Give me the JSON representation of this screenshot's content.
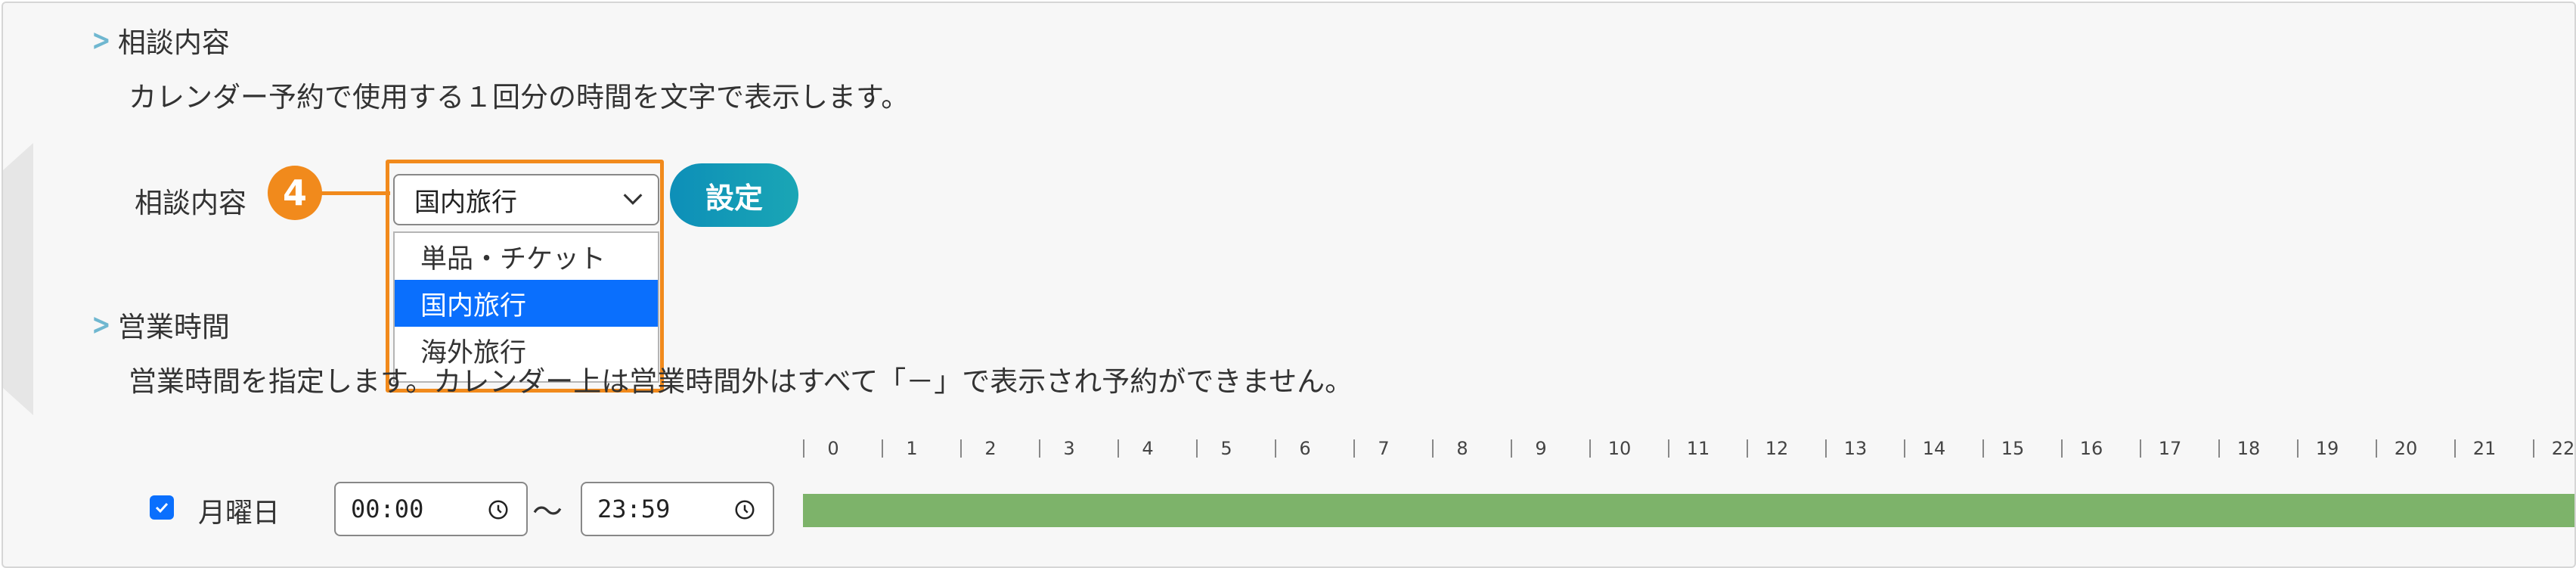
{
  "consultation": {
    "heading": "相談内容",
    "description": "カレンダー予約で使用する１回分の時間を文字で表示します。",
    "field_label": "相談内容",
    "badge": "4",
    "selected": "国内旅行",
    "options": [
      "単品・チケット",
      "国内旅行",
      "海外旅行"
    ],
    "set_button": "設定"
  },
  "business_hours": {
    "heading": "営業時間",
    "description": "営業時間を指定します。カレンダー上は営業時間外はすべて「－」で表示され予約ができません。",
    "hours": [
      "0",
      "1",
      "2",
      "3",
      "4",
      "5",
      "6",
      "7",
      "8",
      "9",
      "10",
      "11",
      "12",
      "13",
      "14",
      "15",
      "16",
      "17",
      "18",
      "19",
      "20",
      "21",
      "22"
    ],
    "rows": [
      {
        "day": "月曜日",
        "checked": true,
        "start": "00:00",
        "end": "23:59"
      }
    ],
    "tilde": "〜"
  },
  "colors": {
    "accent_orange": "#f18a1c",
    "button_teal": "#1aa6b5",
    "selection_blue": "#0a6ffd",
    "bar_green": "#7db36a"
  }
}
